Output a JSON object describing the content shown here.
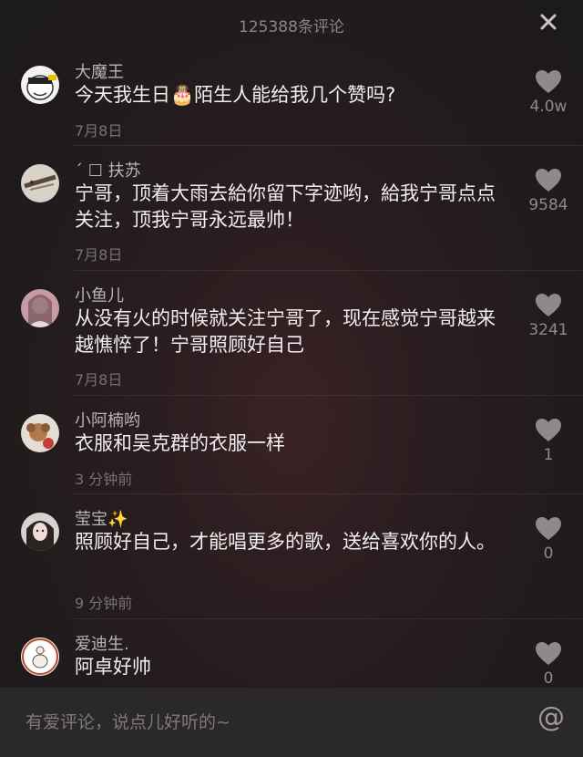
{
  "header": {
    "title": "125388条评论"
  },
  "comments": [
    {
      "user": "大魔王",
      "text": "今天我生日🎂陌生人能给我几个赞吗?",
      "date": "7月8日",
      "likes": "4.0w",
      "avatar": "meme-face-avatar"
    },
    {
      "user": "ˊ ☐  扶苏",
      "text": "宁哥，顶着大雨去給你留下字迹哟，給我宁哥点点关注，顶我宁哥永远最帅！",
      "date": "7月8日",
      "likes": "9584",
      "avatar": "handwriting-photo-avatar"
    },
    {
      "user": "小鱼儿",
      "text": "从没有火的时候就关注宁哥了，现在感觉宁哥越来越憔悴了！宁哥照顾好自己",
      "date": "7月8日",
      "likes": "3241",
      "avatar": "girl-photo-avatar"
    },
    {
      "user": "小阿楠哟",
      "text": "衣服和吴克群的衣服一样",
      "date": "3 分钟前",
      "likes": "1",
      "avatar": "puppy-photo-avatar"
    },
    {
      "user": "莹宝✨",
      "text": "照顾好自己，才能唱更多的歌，送给喜欢你的人。",
      "date": "9 分钟前",
      "likes": "0",
      "avatar": "girl-selfie-avatar"
    },
    {
      "user": "爱迪生.",
      "text": "阿卓好帅",
      "date": "",
      "likes": "0",
      "avatar": "goose-cartoon-avatar"
    }
  ],
  "input": {
    "placeholder": "有爱评论，说点儿好听的~"
  },
  "icons": {
    "close": "close-icon",
    "like": "heart-icon",
    "mention": "at-icon"
  },
  "colors": {
    "background": "#201b1c",
    "text": "#f2eff0",
    "muted": "#77716f",
    "heart": "#8e8a8b"
  }
}
